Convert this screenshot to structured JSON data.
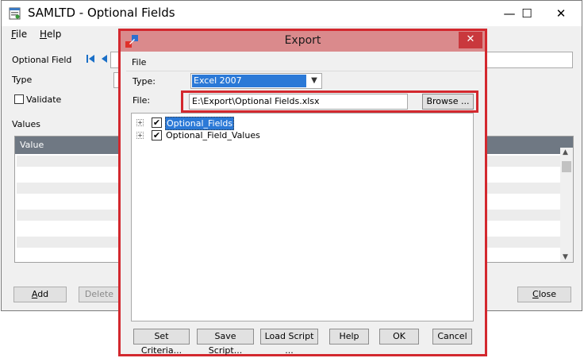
{
  "background_window": {
    "title": "SAMLTD - Optional Fields",
    "window_controls": {
      "minimize": "—",
      "maximize": "☐",
      "close": "✕"
    },
    "menu": [
      {
        "first": "F",
        "rest": "ile"
      },
      {
        "first": "H",
        "rest": "elp"
      }
    ],
    "fields": {
      "optional_field_label": "Optional Field",
      "type_label": "Type",
      "validate_label": "Validate",
      "values_label": "Values"
    },
    "grid": {
      "column_header": "Value"
    },
    "buttons": {
      "add": {
        "first": "A",
        "rest": "dd"
      },
      "delete": "Delete",
      "close": {
        "first": "C",
        "rest": "lose"
      }
    }
  },
  "export_dialog": {
    "title": "Export",
    "close_glyph": "✕",
    "menu_file": "File",
    "type_label": "Type:",
    "type_value": "Excel 2007",
    "file_label": "File:",
    "file_path": "E:\\Export\\Optional Fields.xlsx",
    "browse_label": "Browse ...",
    "tree": [
      {
        "label": "Optional_Fields",
        "checked": true,
        "selected": true
      },
      {
        "label": "Optional_Field_Values",
        "checked": true,
        "selected": false
      }
    ],
    "footer_buttons": {
      "set_criteria": "Set Criteria...",
      "save_script": "Save Script...",
      "load_script": "Load Script ...",
      "help": "Help",
      "ok": "OK",
      "cancel": "Cancel"
    }
  },
  "colors": {
    "dialog_border": "#d3282e",
    "dialog_titlebar": "#da8a8c",
    "selection": "#2b79d7",
    "grid_header": "#6f7883",
    "nav_arrow": "#1a6fc7"
  }
}
